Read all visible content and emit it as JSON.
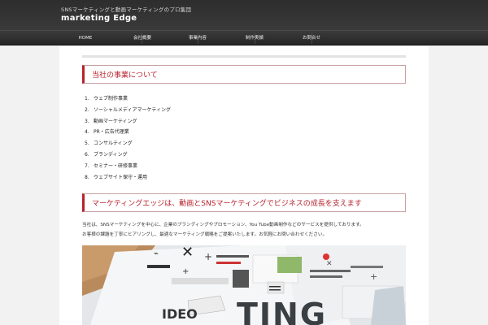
{
  "header": {
    "tagline": "SNSマーケティングと動画マーケティングのプロ集団",
    "site_title": "marketing Edge"
  },
  "nav": {
    "items": [
      "HOME",
      "会社概要",
      "事業内容",
      "制作実績",
      "お問合せ"
    ]
  },
  "section1": {
    "heading": "当社の事業について",
    "items": [
      "ウェブ制作事業",
      "ソーシャルメディアマーケティング",
      "動画マーケティング",
      "PR・広告代理業",
      "コンサルティング",
      "ブランディング",
      "セミナー・研修事業",
      "ウェブサイト保守・運用"
    ]
  },
  "section2": {
    "heading": "マーケティングエッジは、動画とSNSマーケティングでビジネスの成長を支えます",
    "paragraph_lines": [
      "当社は、SNSマーケティングを中心に、企業のブランディングやプロモーション、You Tube動画制作などのサービスを提供しております。",
      "お客様の課題を丁寧にヒアリングし、最適なマーケティング戦略をご提案いたします。お気軽にお問い合わせください。"
    ]
  },
  "hero": {
    "image_word": "TING",
    "video_word": "IDEO"
  }
}
